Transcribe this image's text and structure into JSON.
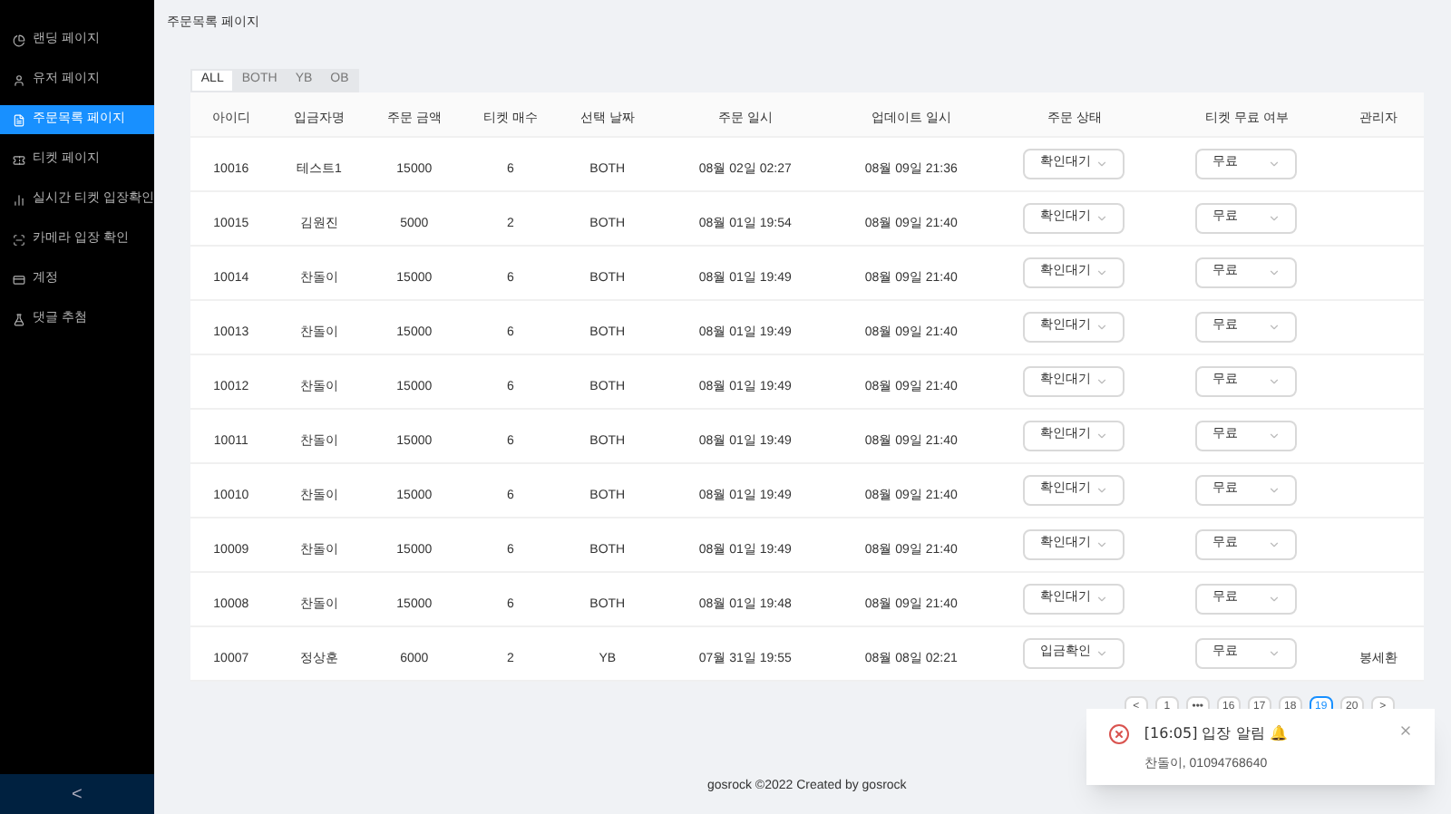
{
  "sidebar": {
    "items": [
      {
        "label": "랜딩 페이지",
        "selected": false
      },
      {
        "label": "유저 페이지",
        "selected": false
      },
      {
        "label": "주문목록 페이지",
        "selected": true
      },
      {
        "label": "티켓 페이지",
        "selected": false
      },
      {
        "label": "실시간 티켓 입장확인",
        "selected": false
      },
      {
        "label": "카메라 입장 확인",
        "selected": false
      },
      {
        "label": "계정",
        "selected": false
      },
      {
        "label": "댓글 추첨",
        "selected": false
      }
    ],
    "collapse": "<"
  },
  "page_title": "주문목록 페이지",
  "tabs": [
    {
      "label": "ALL",
      "selected": true
    },
    {
      "label": "BOTH",
      "selected": false
    },
    {
      "label": "YB",
      "selected": false
    },
    {
      "label": "OB",
      "selected": false
    }
  ],
  "table": {
    "columns": [
      "아이디",
      "입금자명",
      "주문 금액",
      "티켓 매수",
      "선택 날짜",
      "주문 일시",
      "업데이트 일시",
      "주문 상태",
      "티켓 무료 여부",
      "관리자"
    ],
    "rows": [
      {
        "id": "10016",
        "name": "테스트1",
        "amount": "15000",
        "count": "6",
        "date": "BOTH",
        "ordered": "08월 02일 02:27",
        "updated": "08월 09일 21:36",
        "status": "확인대기",
        "free": "무료"
      },
      {
        "id": "10015",
        "name": "김원진",
        "amount": "5000",
        "count": "2",
        "date": "BOTH",
        "ordered": "08월 01일 19:54",
        "updated": "08월 09일 21:40",
        "status": "확인대기",
        "free": "무료"
      },
      {
        "id": "10014",
        "name": "찬돌이",
        "amount": "15000",
        "count": "6",
        "date": "BOTH",
        "ordered": "08월 01일 19:49",
        "updated": "08월 09일 21:40",
        "status": "확인대기",
        "free": "무료"
      },
      {
        "id": "10013",
        "name": "찬돌이",
        "amount": "15000",
        "count": "6",
        "date": "BOTH",
        "ordered": "08월 01일 19:49",
        "updated": "08월 09일 21:40",
        "status": "확인대기",
        "free": "무료"
      },
      {
        "id": "10012",
        "name": "찬돌이",
        "amount": "15000",
        "count": "6",
        "date": "BOTH",
        "ordered": "08월 01일 19:49",
        "updated": "08월 09일 21:40",
        "status": "확인대기",
        "free": "무료"
      },
      {
        "id": "10011",
        "name": "찬돌이",
        "amount": "15000",
        "count": "6",
        "date": "BOTH",
        "ordered": "08월 01일 19:49",
        "updated": "08월 09일 21:40",
        "status": "확인대기",
        "free": "무료"
      },
      {
        "id": "10010",
        "name": "찬돌이",
        "amount": "15000",
        "count": "6",
        "date": "BOTH",
        "ordered": "08월 01일 19:49",
        "updated": "08월 09일 21:40",
        "status": "확인대기",
        "free": "무료"
      },
      {
        "id": "10009",
        "name": "찬돌이",
        "amount": "15000",
        "count": "6",
        "date": "BOTH",
        "ordered": "08월 01일 19:49",
        "updated": "08월 09일 21:40",
        "status": "확인대기",
        "free": "무료"
      },
      {
        "id": "10008",
        "name": "찬돌이",
        "amount": "15000",
        "count": "6",
        "date": "BOTH",
        "ordered": "08월 01일 19:48",
        "updated": "08월 09일 21:40",
        "status": "확인대기",
        "free": "무료"
      },
      {
        "id": "10007",
        "name": "정상훈",
        "amount": "6000",
        "count": "2",
        "date": "YB",
        "ordered": "07월 31일 19:55",
        "updated": "08월 08일 02:21",
        "status": "입금확인",
        "free": "무료",
        "admin": "봉세환"
      }
    ]
  },
  "pagination": [
    {
      "label": "<",
      "selected": false
    },
    {
      "label": "1",
      "selected": false
    },
    {
      "label": "•••",
      "selected": false
    },
    {
      "label": "16",
      "selected": false
    },
    {
      "label": "17",
      "selected": false
    },
    {
      "label": "18",
      "selected": false
    },
    {
      "label": "19",
      "selected": true
    },
    {
      "label": "20",
      "selected": false
    },
    {
      "label": ">",
      "selected": false
    }
  ],
  "notification": {
    "title": "[16:05] 입장 알림 🔔",
    "message": "찬돌이, 01094768640"
  },
  "footer": "gosrock ©2022 Created by gosrock"
}
